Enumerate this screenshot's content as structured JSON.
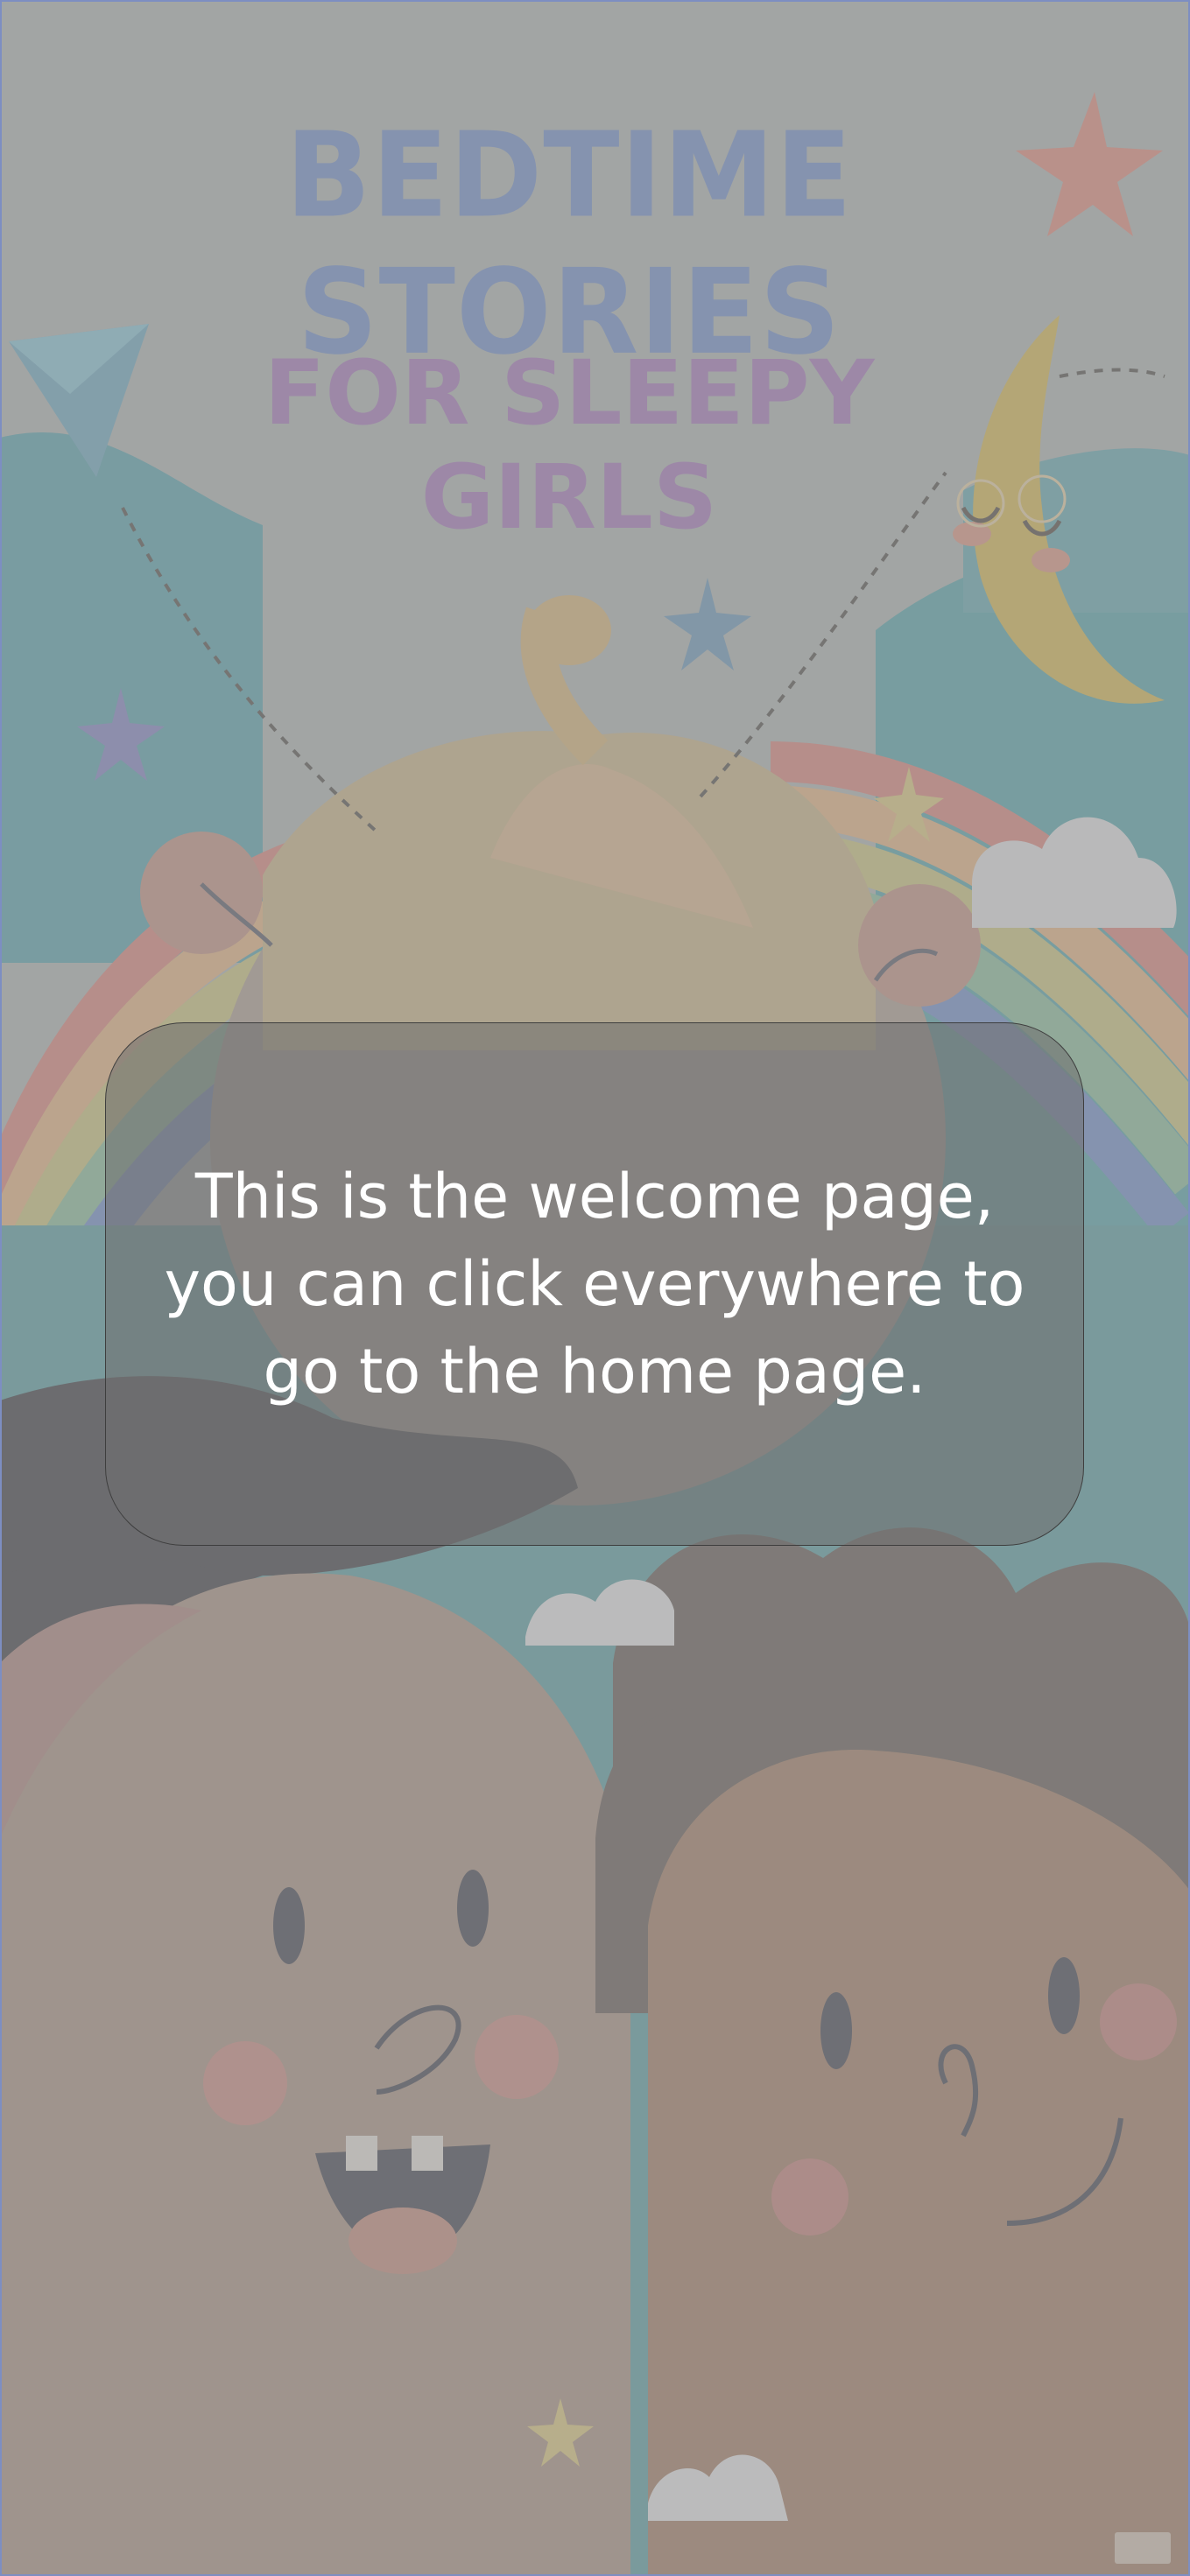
{
  "cover": {
    "title": "BEDTIME STORIES",
    "subtitle": "FOR SLEEPY GIRLS"
  },
  "dialog": {
    "message": "This is the welcome page, you can click everywhere to go to the home page."
  },
  "colors": {
    "title": "#7f92b9",
    "subtitle": "#a083ae",
    "dialog_background": "#707070",
    "dialog_text": "#ffffff"
  }
}
